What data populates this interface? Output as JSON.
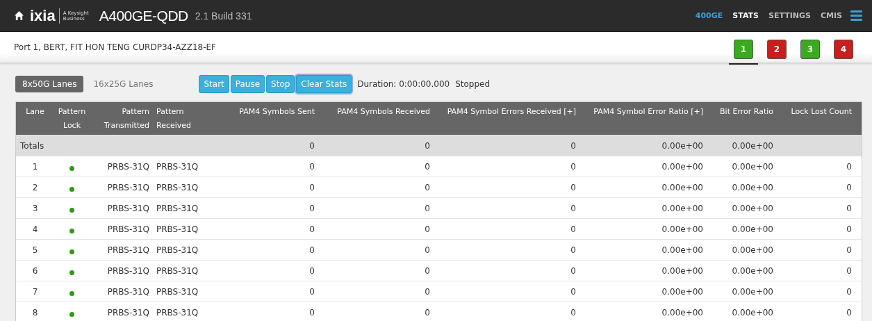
{
  "header": {
    "logo": "ixia",
    "tagline": "A Keysight Business",
    "device": "A400GE-QDD",
    "version": "2.1 Build 331",
    "nav": [
      {
        "label": "400GE",
        "kind": "device",
        "selected": false
      },
      {
        "label": "STATS",
        "kind": "page",
        "selected": true
      },
      {
        "label": "SETTINGS",
        "kind": "page",
        "selected": false
      },
      {
        "label": "CMIS",
        "kind": "page",
        "selected": false
      }
    ]
  },
  "port_bar": {
    "title": "Port 1, BERT, FIT HON TENG CURDP34-AZZ18-EF",
    "ports": [
      {
        "label": "1",
        "color": "#3aaa1e",
        "selected": true
      },
      {
        "label": "2",
        "color": "#c81e1e",
        "selected": false
      },
      {
        "label": "3",
        "color": "#3aaa1e",
        "selected": false
      },
      {
        "label": "4",
        "color": "#c81e1e",
        "selected": false
      }
    ]
  },
  "lane_tabs": [
    {
      "label": "8x50G Lanes",
      "selected": true
    },
    {
      "label": "16x25G Lanes",
      "selected": false
    }
  ],
  "buttons": [
    {
      "label": "Start",
      "focused": false
    },
    {
      "label": "Pause",
      "focused": false
    },
    {
      "label": "Stop",
      "focused": false
    },
    {
      "label": "Clear Stats",
      "focused": true
    }
  ],
  "duration": "Duration: 0:00:00.000",
  "run_state": "Stopped",
  "table": {
    "columns": [
      "Lane",
      "Pattern Lock",
      "Pattern Transmitted",
      "Pattern Received",
      "PAM4 Symbols Sent",
      "PAM4 Symbols Received",
      "PAM4 Symbol Errors Received [+]",
      "PAM4 Symbol Error Ratio [+]",
      "Bit Error Ratio",
      "Lock Lost Count"
    ],
    "totals": {
      "label": "Totals",
      "sent": "0",
      "received": "0",
      "errors": "0",
      "ratio": "0.00e+00",
      "ber": "0.00e+00"
    },
    "rows": [
      {
        "lane": "1",
        "lock": true,
        "tx": "PRBS-31Q",
        "rx": "PRBS-31Q",
        "sent": "0",
        "received": "0",
        "errors": "0",
        "ratio": "0.00e+00",
        "ber": "0.00e+00",
        "lost": "0"
      },
      {
        "lane": "2",
        "lock": true,
        "tx": "PRBS-31Q",
        "rx": "PRBS-31Q",
        "sent": "0",
        "received": "0",
        "errors": "0",
        "ratio": "0.00e+00",
        "ber": "0.00e+00",
        "lost": "0"
      },
      {
        "lane": "3",
        "lock": true,
        "tx": "PRBS-31Q",
        "rx": "PRBS-31Q",
        "sent": "0",
        "received": "0",
        "errors": "0",
        "ratio": "0.00e+00",
        "ber": "0.00e+00",
        "lost": "0"
      },
      {
        "lane": "4",
        "lock": true,
        "tx": "PRBS-31Q",
        "rx": "PRBS-31Q",
        "sent": "0",
        "received": "0",
        "errors": "0",
        "ratio": "0.00e+00",
        "ber": "0.00e+00",
        "lost": "0"
      },
      {
        "lane": "5",
        "lock": true,
        "tx": "PRBS-31Q",
        "rx": "PRBS-31Q",
        "sent": "0",
        "received": "0",
        "errors": "0",
        "ratio": "0.00e+00",
        "ber": "0.00e+00",
        "lost": "0"
      },
      {
        "lane": "6",
        "lock": true,
        "tx": "PRBS-31Q",
        "rx": "PRBS-31Q",
        "sent": "0",
        "received": "0",
        "errors": "0",
        "ratio": "0.00e+00",
        "ber": "0.00e+00",
        "lost": "0"
      },
      {
        "lane": "7",
        "lock": true,
        "tx": "PRBS-31Q",
        "rx": "PRBS-31Q",
        "sent": "0",
        "received": "0",
        "errors": "0",
        "ratio": "0.00e+00",
        "ber": "0.00e+00",
        "lost": "0"
      },
      {
        "lane": "8",
        "lock": true,
        "tx": "PRBS-31Q",
        "rx": "PRBS-31Q",
        "sent": "0",
        "received": "0",
        "errors": "0",
        "ratio": "0.00e+00",
        "ber": "0.00e+00",
        "lost": "0"
      }
    ]
  }
}
